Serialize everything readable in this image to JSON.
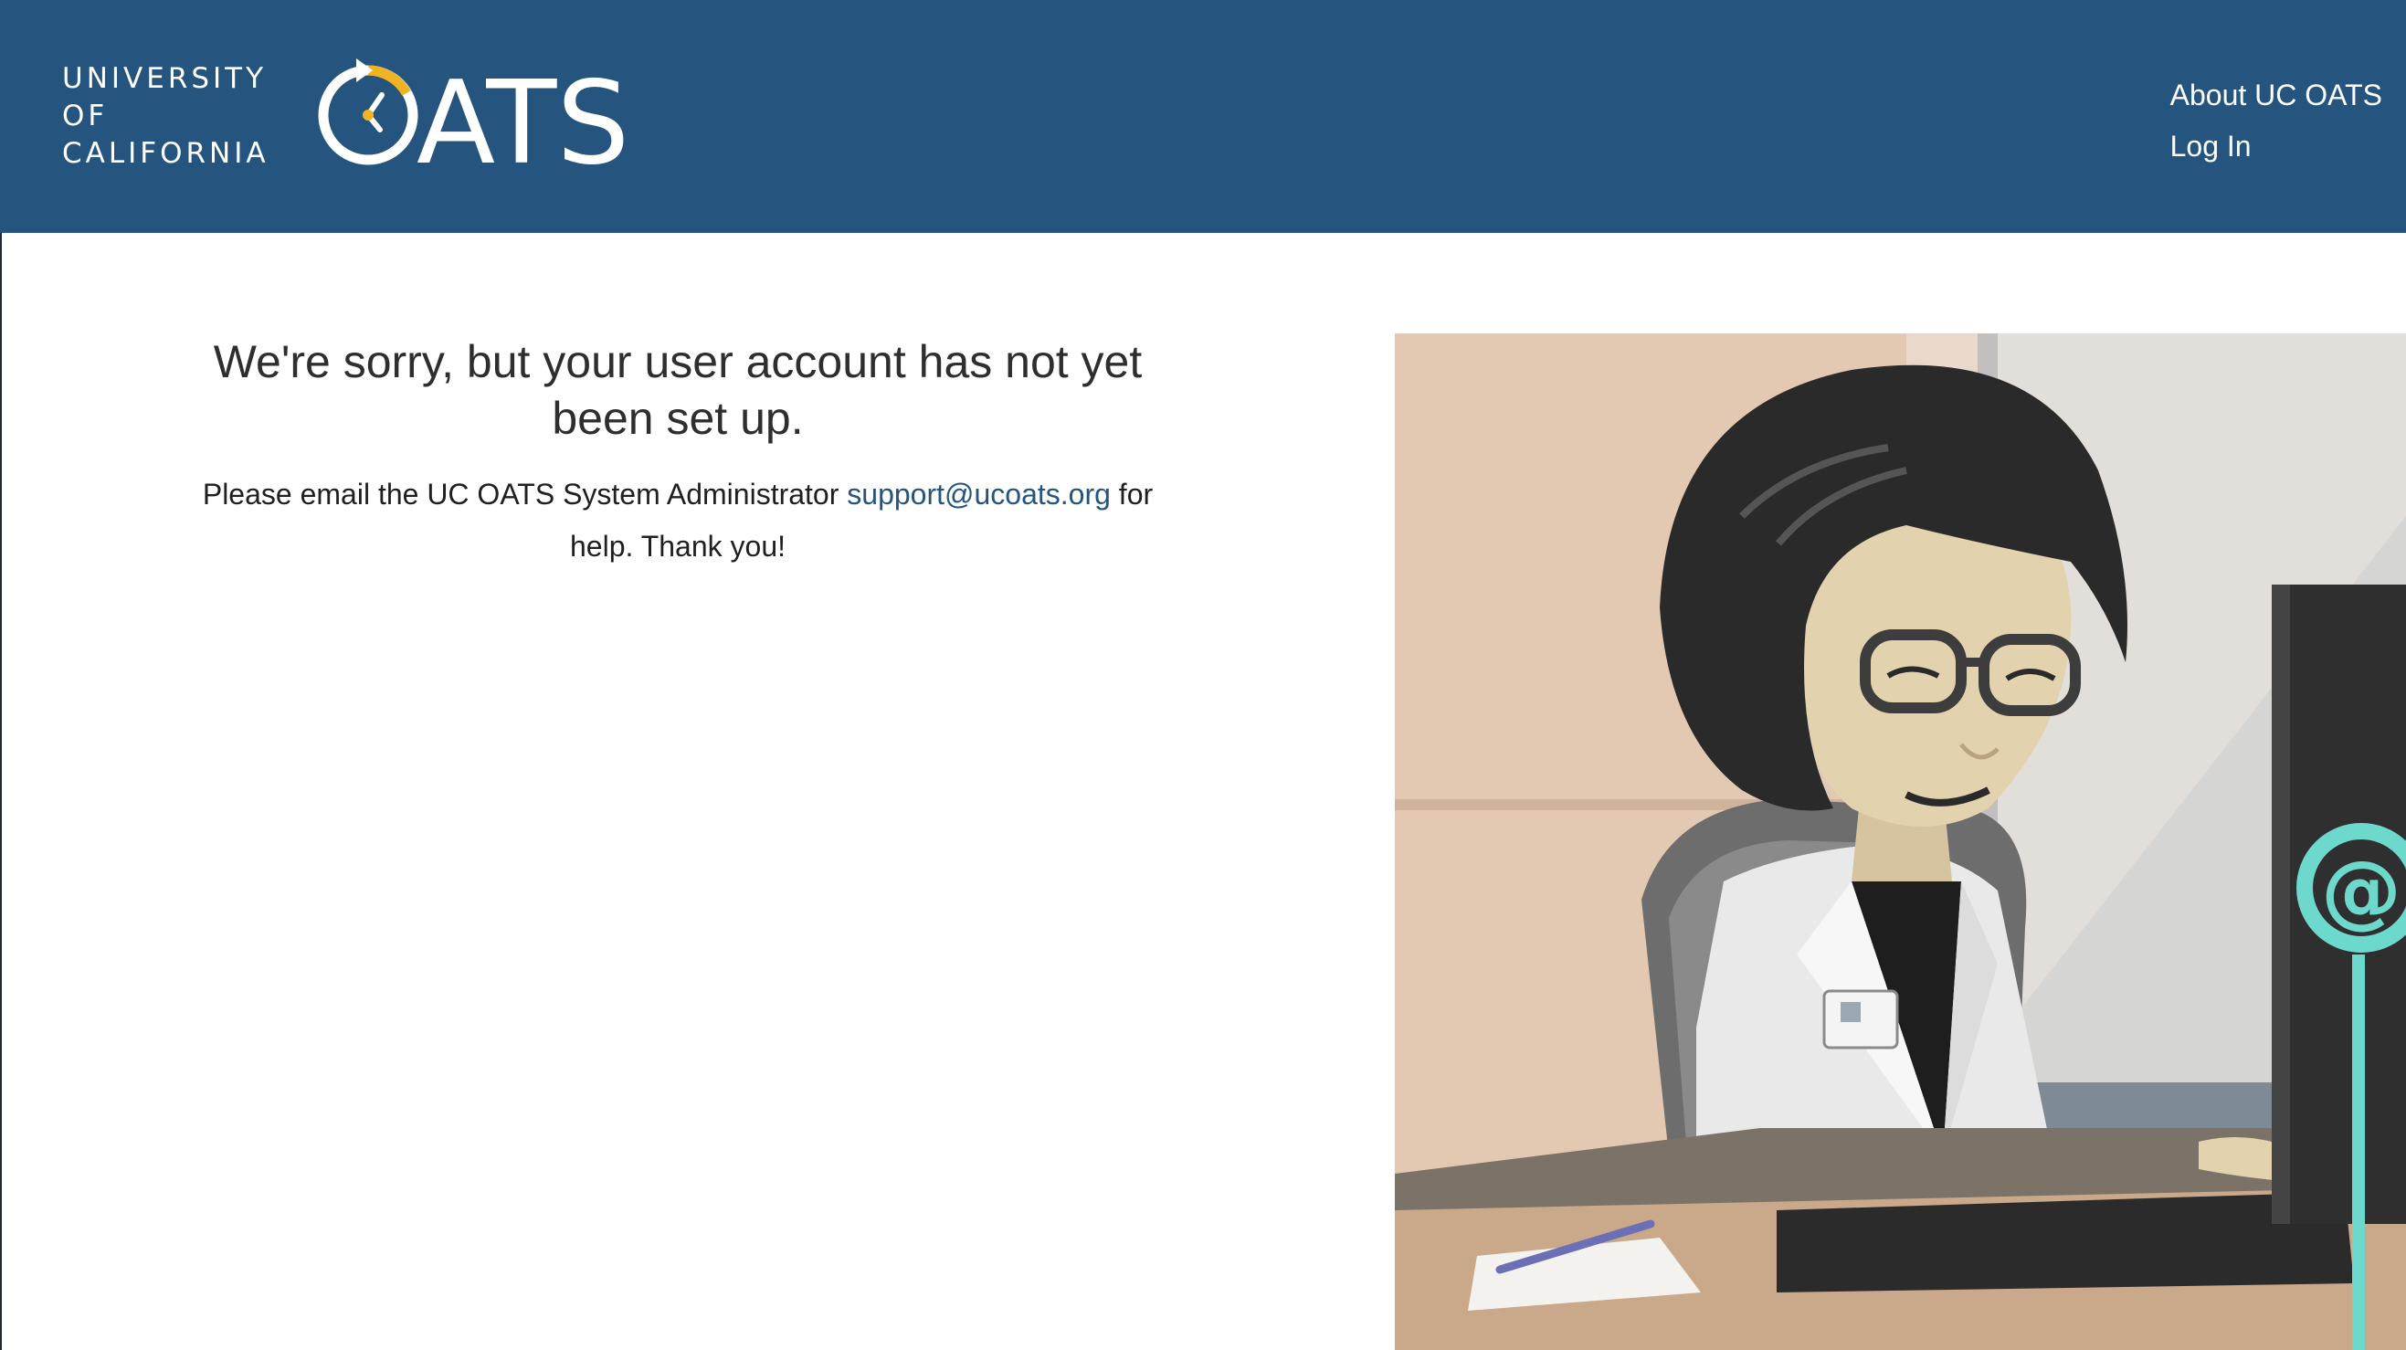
{
  "header": {
    "university_lines": [
      "UNIVERSITY",
      "OF",
      "CALIFORNIA"
    ],
    "oats_wordmark": "ATS",
    "nav": {
      "about_label": "About UC OATS",
      "login_label": "Log In"
    },
    "bg_color": "#25557f"
  },
  "message": {
    "heading": "We're sorry, but your user account has not yet been set up.",
    "body_prefix": "Please email the UC OATS System Administrator ",
    "email": "support@ucoats.org",
    "body_suffix": " for help. Thank you!"
  },
  "illustration": {
    "email_sign_symbol": "@"
  }
}
